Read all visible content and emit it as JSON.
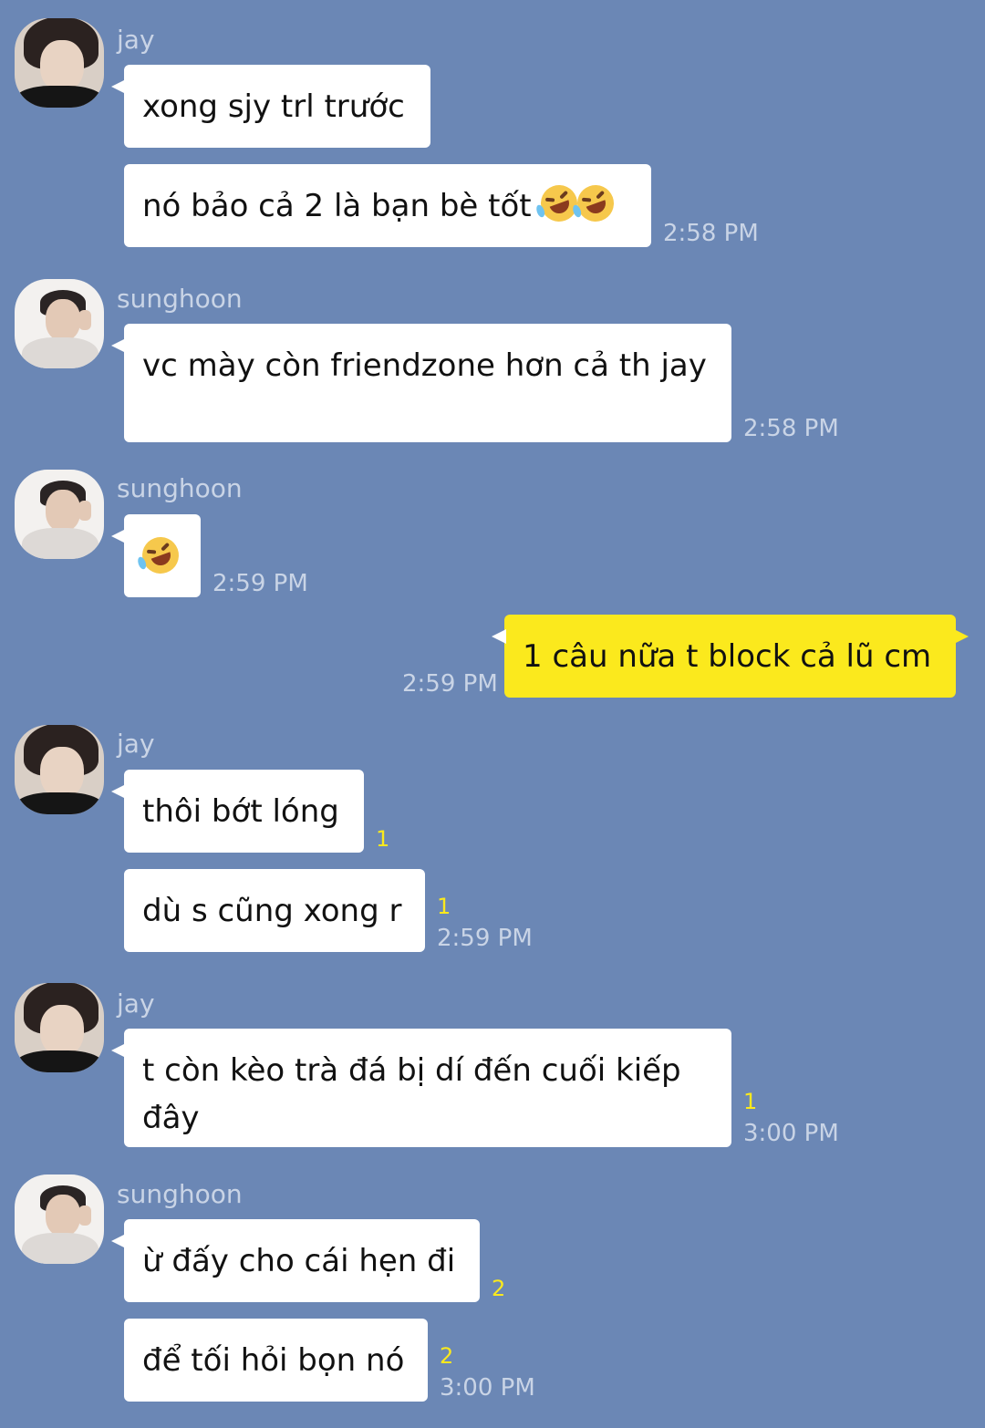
{
  "colors": {
    "background": "#6b87b5",
    "incoming_bubble": "#ffffff",
    "outgoing_bubble": "#fbe91d",
    "unread_count": "#fbe91d",
    "meta_text": "#c9d4e6"
  },
  "groups": [
    {
      "sender": "jay",
      "messages": [
        {
          "text": "xong sjy trl trước"
        },
        {
          "text": "nó bảo cả 2 là bạn bè tốt",
          "emoji": [
            "rolling-on-floor-laughing",
            "rolling-on-floor-laughing"
          ],
          "time": "2:58 PM"
        }
      ]
    },
    {
      "sender": "sunghoon",
      "messages": [
        {
          "text": "vc mày còn friendzone hơn cả th jay",
          "time": "2:58 PM"
        }
      ]
    },
    {
      "sender": "sunghoon",
      "messages": [
        {
          "emoji": [
            "rolling-on-floor-laughing"
          ],
          "time": "2:59 PM"
        }
      ]
    },
    {
      "sender": "me",
      "messages": [
        {
          "text": "1 câu nữa t block cả lũ cm",
          "time": "2:59 PM"
        }
      ]
    },
    {
      "sender": "jay",
      "messages": [
        {
          "text": "thôi bớt lóng",
          "unread": "1"
        },
        {
          "text": "dù s cũng xong r",
          "unread": "1",
          "time": "2:59 PM"
        }
      ]
    },
    {
      "sender": "jay",
      "messages": [
        {
          "text": "t còn kèo trà đá bị dí đến cuối kiếp đây",
          "unread": "1",
          "time": "3:00 PM"
        }
      ]
    },
    {
      "sender": "sunghoon",
      "messages": [
        {
          "text": "ừ đấy cho cái hẹn đi",
          "unread": "2"
        },
        {
          "text": "để tối hỏi bọn nó",
          "unread": "2",
          "time": "3:00 PM"
        }
      ]
    }
  ]
}
